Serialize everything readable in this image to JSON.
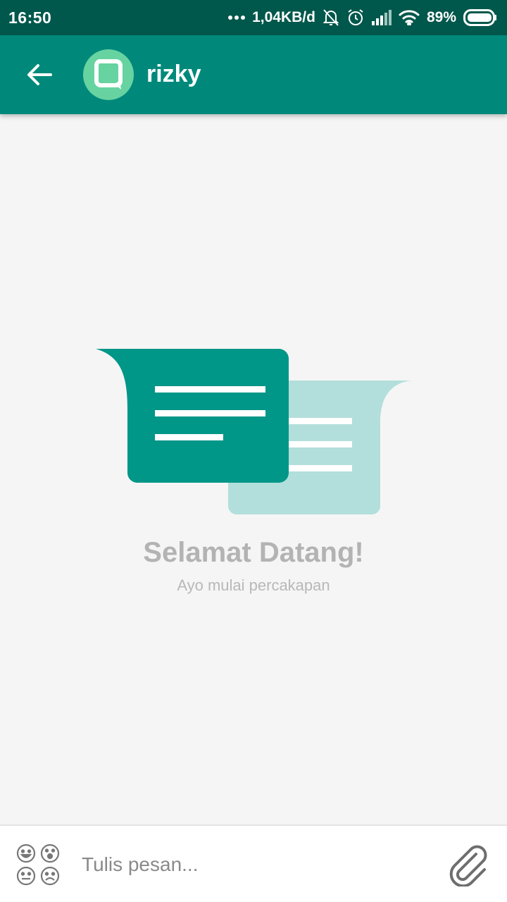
{
  "status_bar": {
    "time": "16:50",
    "network_speed": "1,04KB/d",
    "battery": "89%",
    "icons": [
      "more-dots-icon",
      "bell-off-icon",
      "alarm-icon",
      "signal-icon",
      "wifi-icon",
      "battery-icon"
    ]
  },
  "header": {
    "back_icon": "arrow-left-icon",
    "avatar_icon": "q-logo-icon",
    "contact_name": "rizky"
  },
  "empty_state": {
    "illustration": "chat-bubbles-icon",
    "title": "Selamat Datang!",
    "subtitle": "Ayo mulai percakapan"
  },
  "composer": {
    "emoji_icon": "emoji-faces-icon",
    "placeholder": "Tulis pesan...",
    "value": "",
    "attach_icon": "paperclip-icon"
  },
  "colors": {
    "status_bar": "#00574b",
    "app_bar": "#00897b",
    "bubble_primary": "#009688",
    "bubble_secondary": "#b2dfdb",
    "avatar": "#66d3a0",
    "background": "#f5f5f5"
  }
}
